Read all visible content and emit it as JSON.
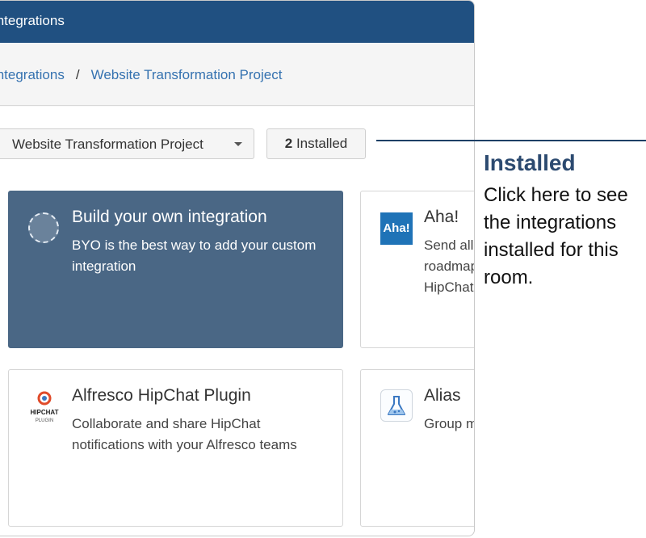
{
  "header": {
    "title": "Integrations"
  },
  "breadcrumb": {
    "root": "Integrations",
    "separator": "/",
    "current": "Website Transformation Project"
  },
  "toolbar": {
    "room_select": "Website Transformation Project",
    "installed_count": "2",
    "installed_label": "Installed"
  },
  "cards": [
    {
      "title": "Build your own integration",
      "description": "BYO is the best way to add your custom integration"
    },
    {
      "title": "Aha!",
      "icon_text": "Aha!",
      "description": "Send all roadmap HipChat"
    },
    {
      "title": "Alfresco HipChat Plugin",
      "icon_text": "HIPCHAT",
      "icon_subtext": "PLUGIN",
      "description": "Collaborate and share HipChat notifications with your Alfresco teams"
    },
    {
      "title": "Alias",
      "description": "Group m"
    }
  ],
  "callout": {
    "title": "Installed",
    "body": "Click here to see the integrations installed for this room."
  },
  "colors": {
    "header": "#205081",
    "link": "#3572b0",
    "featured_card": "#4a6785",
    "callout_title": "#2c4a70"
  },
  "icons": [
    "byo-icon",
    "aha-icon",
    "alfresco-icon",
    "alias-flask-icon",
    "caret-down-icon"
  ]
}
